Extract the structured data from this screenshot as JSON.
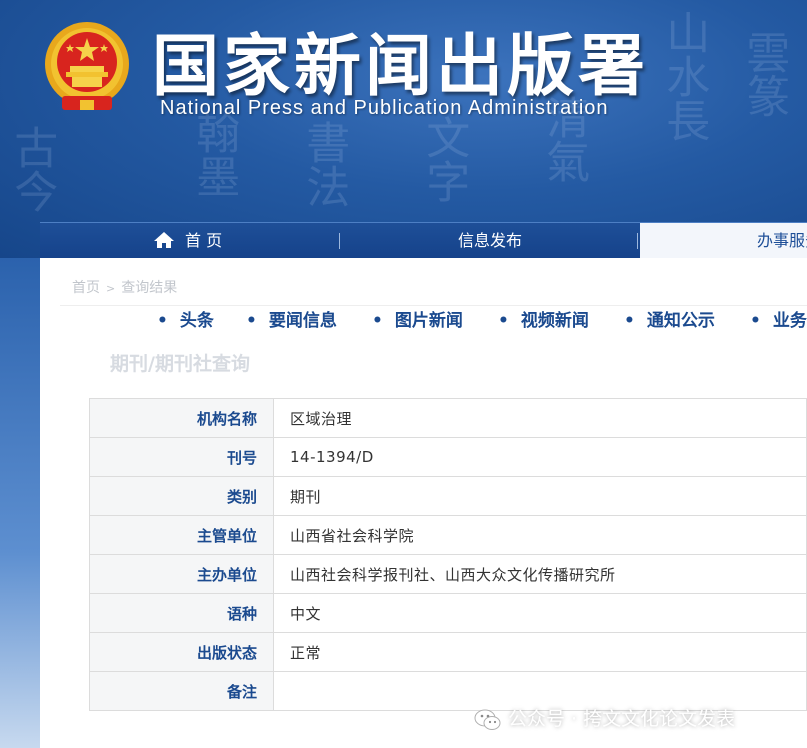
{
  "header": {
    "title": "国家新闻出版署",
    "subtitle": "National  Press and Publication Administration"
  },
  "nav": {
    "home": "首 页",
    "info": "信息发布",
    "service": "办事服务"
  },
  "breadcrumb": [
    "首页",
    "查询结果"
  ],
  "subnav": [
    "头条",
    "要闻信息",
    "图片新闻",
    "视频新闻",
    "通知公示",
    "业务动态"
  ],
  "page_heading": "期刊/期刊社查询",
  "record": [
    {
      "label": "机构名称",
      "value": "区域治理"
    },
    {
      "label": "刊号",
      "value": "14-1394/D"
    },
    {
      "label": "类别",
      "value": "期刊"
    },
    {
      "label": "主管单位",
      "value": "山西省社会科学院"
    },
    {
      "label": "主办单位",
      "value": "山西社会科学报刊社、山西大众文化传播研究所"
    },
    {
      "label": "语种",
      "value": "中文"
    },
    {
      "label": "出版状态",
      "value": "正常"
    },
    {
      "label": "备注",
      "value": ""
    }
  ],
  "watermark": "公众号 · 挎文文化论文发表",
  "icons": [
    "national-emblem",
    "home-icon",
    "wechat-icon"
  ],
  "colors": {
    "brand_blue": "#1b4a8f",
    "emblem_red": "#d8241e",
    "emblem_gold": "#f2c230"
  }
}
